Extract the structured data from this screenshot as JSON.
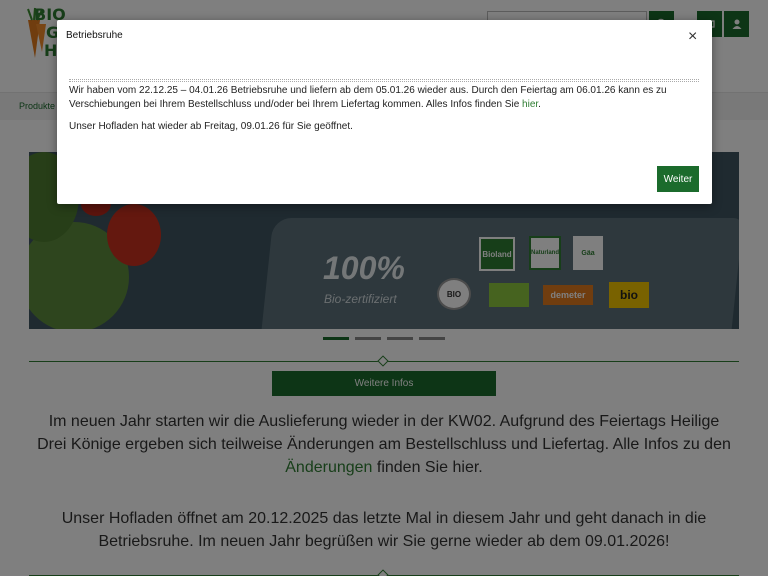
{
  "header": {
    "logo_lines": [
      "BIO",
      "G",
      "H"
    ],
    "nav_item": "Produkte"
  },
  "banner": {
    "headline": "100%",
    "subline": "Bio-zertifiziert",
    "seals": [
      "Bioland",
      "Naturland",
      "Gäa",
      "BIO",
      "EU-Bio",
      "demeter",
      "bio"
    ]
  },
  "carousel": {
    "slides": 4,
    "active": 1
  },
  "main": {
    "more_button": "Weitere Infos",
    "para1_before": "Im neuen Jahr starten wir die Auslieferung wieder in der KW02. Aufgrund des Feiertags Heilige Drei Könige ergeben sich teilweise Änderungen am Bestellschluss und Liefertag. Alle Infos zu den ",
    "para1_link": "Änderungen",
    "para1_after": " finden Sie hier.",
    "para2": "Unser Hofladen öffnet am 20.12.2025 das letzte Mal in diesem Jahr und geht danach in die Betriebsruhe. Im neuen Jahr begrüßen wir Sie gerne wieder ab dem 09.01.2026!"
  },
  "modal": {
    "title": "Betriebsruhe",
    "close": "×",
    "p1_text": "Wir haben vom 22.12.25 – 04.01.26 Betriebsruhe und liefern ab dem 05.01.26 wieder aus. Durch den Feiertag am 06.01.26 kann es zu Verschiebungen bei Ihrem Bestellschluss und/oder bei Ihrem Liefertag kommen. Alles Infos finden Sie ",
    "p1_link": "hier",
    "p1_end": ".",
    "p2": "Unser Hofladen hat wieder ab Freitag, 09.01.26 für Sie geöffnet.",
    "button": "Weiter"
  },
  "colors": {
    "brand_green": "#1b6b2c",
    "link_green": "#2e7d32",
    "overlay": "rgba(0,0,0,0.5)"
  }
}
